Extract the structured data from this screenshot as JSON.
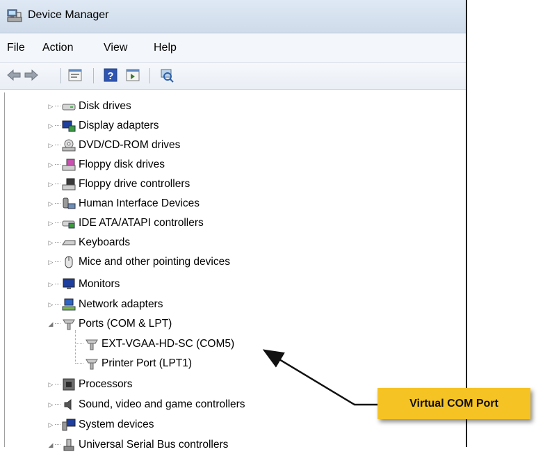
{
  "window": {
    "title": "Device Manager"
  },
  "menu": [
    "File",
    "Action",
    "View",
    "Help"
  ],
  "toolbar": [
    "back-icon",
    "forward-icon",
    "properties-icon",
    "help-icon",
    "update-driver-icon",
    "scan-hardware-icon"
  ],
  "tree": [
    {
      "label": "Disk drives",
      "icon": "disk-drive-icon",
      "expanded": false
    },
    {
      "label": "Display adapters",
      "icon": "display-adapter-icon",
      "expanded": false
    },
    {
      "label": "DVD/CD-ROM drives",
      "icon": "dvd-drive-icon",
      "expanded": false
    },
    {
      "label": "Floppy disk drives",
      "icon": "floppy-drive-icon",
      "expanded": false
    },
    {
      "label": "Floppy drive controllers",
      "icon": "floppy-controller-icon",
      "expanded": false
    },
    {
      "label": "Human Interface Devices",
      "icon": "hid-icon",
      "expanded": false
    },
    {
      "label": "IDE ATA/ATAPI controllers",
      "icon": "ide-controller-icon",
      "expanded": false
    },
    {
      "label": "Keyboards",
      "icon": "keyboard-icon",
      "expanded": false
    },
    {
      "label": "Mice and other pointing devices",
      "icon": "mouse-icon",
      "expanded": false
    },
    {
      "label": "Monitors",
      "icon": "monitor-icon",
      "expanded": false
    },
    {
      "label": "Network adapters",
      "icon": "network-adapter-icon",
      "expanded": false
    },
    {
      "label": "Ports (COM & LPT)",
      "icon": "port-icon",
      "expanded": true,
      "children": [
        {
          "label": "EXT-VGAA-HD-SC (COM5)",
          "icon": "port-icon"
        },
        {
          "label": "Printer Port (LPT1)",
          "icon": "port-icon"
        }
      ]
    },
    {
      "label": "Processors",
      "icon": "processor-icon",
      "expanded": false
    },
    {
      "label": "Sound, video and game controllers",
      "icon": "sound-icon",
      "expanded": false
    },
    {
      "label": "System devices",
      "icon": "system-device-icon",
      "expanded": false
    },
    {
      "label": "Universal Serial Bus controllers",
      "icon": "usb-controller-icon",
      "expanded": true
    }
  ],
  "callout": {
    "text": "Virtual COM Port",
    "color": "#f6c325"
  }
}
